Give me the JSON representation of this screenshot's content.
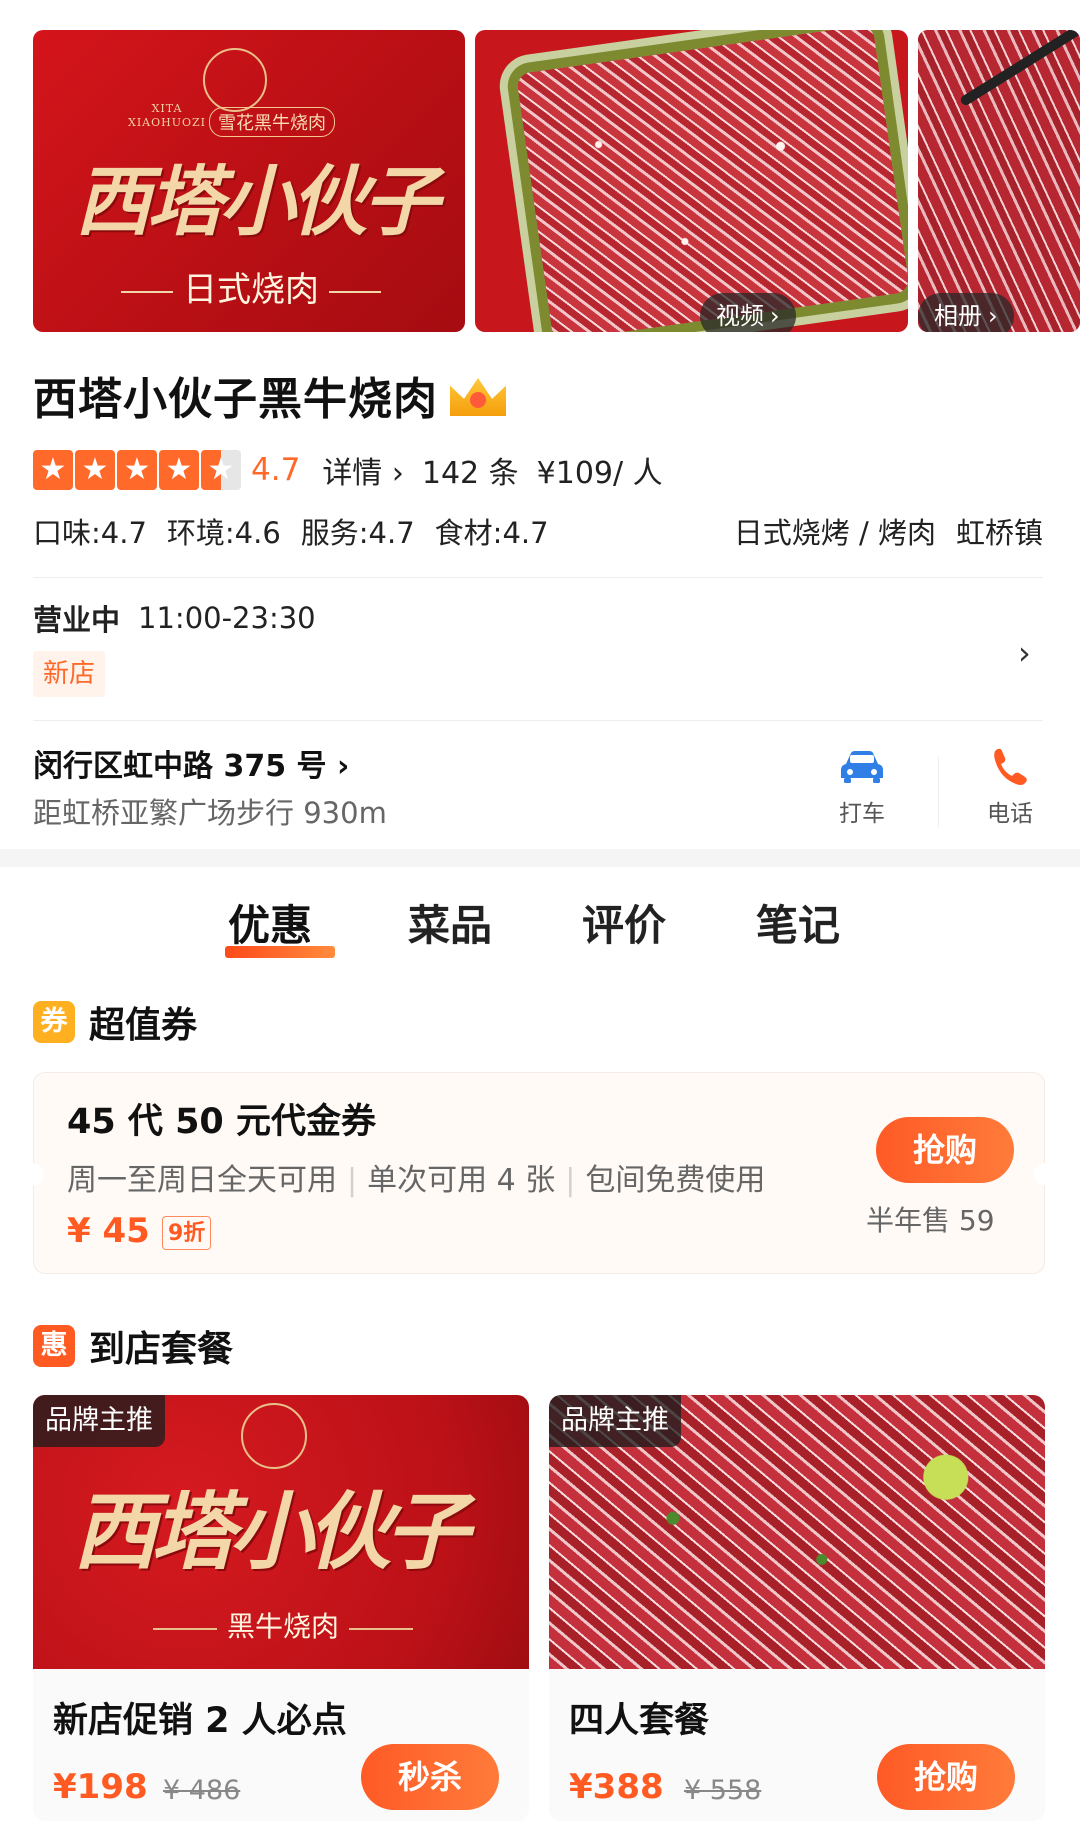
{
  "gallery": {
    "logo_latin_1": "XITA",
    "logo_latin_2": "XIAOHUOZI",
    "logo_sub": "雪花黑牛烧肉",
    "brand_art": "西塔小伙子",
    "tagline": "日式烧肉",
    "video_label": "视频",
    "album_label": "相册"
  },
  "shop": {
    "name": "西塔小伙子黑牛烧肉",
    "rating": "4.7",
    "detail_link": "详情",
    "reviews": "142 条",
    "avg_price": "¥109/ 人",
    "scores": [
      "口味:4.7",
      "环境:4.6",
      "服务:4.7",
      "食材:4.7"
    ],
    "category": "日式烧烤 / 烤肉",
    "district": "虹桥镇",
    "status": "营业中",
    "hours": "11:00-23:30",
    "new_badge": "新店",
    "address": "闵行区虹中路 375 号",
    "distance": "距虹桥亚繁广场步行 930m",
    "taxi_label": "打车",
    "phone_label": "电话"
  },
  "tabs": [
    "优惠",
    "菜品",
    "评价",
    "笔记"
  ],
  "voucher_section": {
    "badge": "券",
    "title": "超值券",
    "voucher_title": "45 代 50 元代金券",
    "terms": [
      "周一至周日全天可用",
      "单次可用 4 张",
      "包间免费使用"
    ],
    "price": "¥ 45",
    "discount": "9折",
    "buy_label": "抢购",
    "sold": "半年售 59"
  },
  "package_section": {
    "badge": "惠",
    "title": "到店套餐",
    "packages": [
      {
        "tag": "品牌主推",
        "brand_art": "西塔小伙子",
        "brand_sub": "黑牛烧肉",
        "name": "新店促销 2 人必点",
        "price": "¥198",
        "orig": "¥ 486",
        "button": "秒杀"
      },
      {
        "tag": "品牌主推",
        "name": "四人套餐",
        "price": "¥388",
        "orig": "¥ 558",
        "button": "抢购"
      }
    ]
  },
  "colors": {
    "accent": "#ff5a22",
    "brand_red": "#c8161d",
    "gold": "#f4d7a8"
  }
}
